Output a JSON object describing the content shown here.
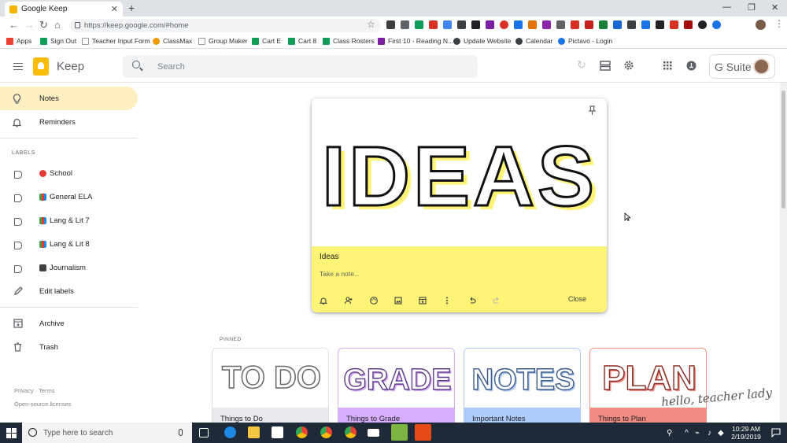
{
  "browser": {
    "tab_title": "Google Keep",
    "url": "https://keep.google.com/#home",
    "bookmarks": [
      "Apps",
      "Sign Out",
      "Teacher Input Form",
      "ClassMax",
      "Group Maker",
      "Cart E",
      "Cart 8",
      "Class Rosters",
      "First 10 - Reading N...",
      "Update Website",
      "Calendar",
      "Pictavo - Login"
    ]
  },
  "app": {
    "name": "Keep",
    "search_placeholder": "Search",
    "gsuite_label": "G Suite"
  },
  "sidebar": {
    "items": [
      {
        "label": "Notes",
        "icon": "lightbulb-icon",
        "active": true
      },
      {
        "label": "Reminders",
        "icon": "bell-icon",
        "active": false
      }
    ],
    "labels_header": "LABELS",
    "labels": [
      {
        "label": "School",
        "emoji_icon": "apple-icon",
        "color": "#e53935"
      },
      {
        "label": "General ELA",
        "emoji_icon": "books-icon",
        "color": "#43a047"
      },
      {
        "label": "Lang & Lit 7",
        "emoji_icon": "books-icon",
        "color": "#43a047"
      },
      {
        "label": "Lang & Lit 8",
        "emoji_icon": "books-icon",
        "color": "#43a047"
      },
      {
        "label": "Journalism",
        "emoji_icon": "camera-icon",
        "color": "#424242"
      }
    ],
    "edit_labels": "Edit labels",
    "archive": "Archive",
    "trash": "Trash",
    "footer": {
      "privacy": "Privacy",
      "separator": "·",
      "terms": "Terms",
      "licenses": "Open-source licenses"
    }
  },
  "open_note": {
    "image_text": "IDEAS",
    "title": "Ideas",
    "placeholder": "Take a note...",
    "close_label": "Close",
    "color": "#fff475",
    "toolbar_icons": [
      "remind-me-icon",
      "collaborator-icon",
      "palette-icon",
      "add-image-icon",
      "archive-icon",
      "more-icon",
      "undo-icon",
      "redo-icon"
    ]
  },
  "pinned": {
    "header": "PINNED",
    "cards": [
      {
        "image_text": "TO DO",
        "caption": "Things to Do",
        "color": "#e8eaed",
        "accent": "#ffffff"
      },
      {
        "image_text": "GRADE",
        "caption": "Things to Grade",
        "color": "#d7aefb",
        "accent": "#d7aefb"
      },
      {
        "image_text": "NOTES",
        "caption": "Important Notes",
        "color": "#aecbfa",
        "accent": "#aecbfa"
      },
      {
        "image_text": "PLAN",
        "caption": "Things to Plan",
        "color": "#f28b82",
        "accent": "#f28b82"
      }
    ]
  },
  "watermark": "hello, teacher lady",
  "taskbar": {
    "search_placeholder": "Type here to search",
    "time": "10:29 AM",
    "date": "2/19/2019"
  }
}
